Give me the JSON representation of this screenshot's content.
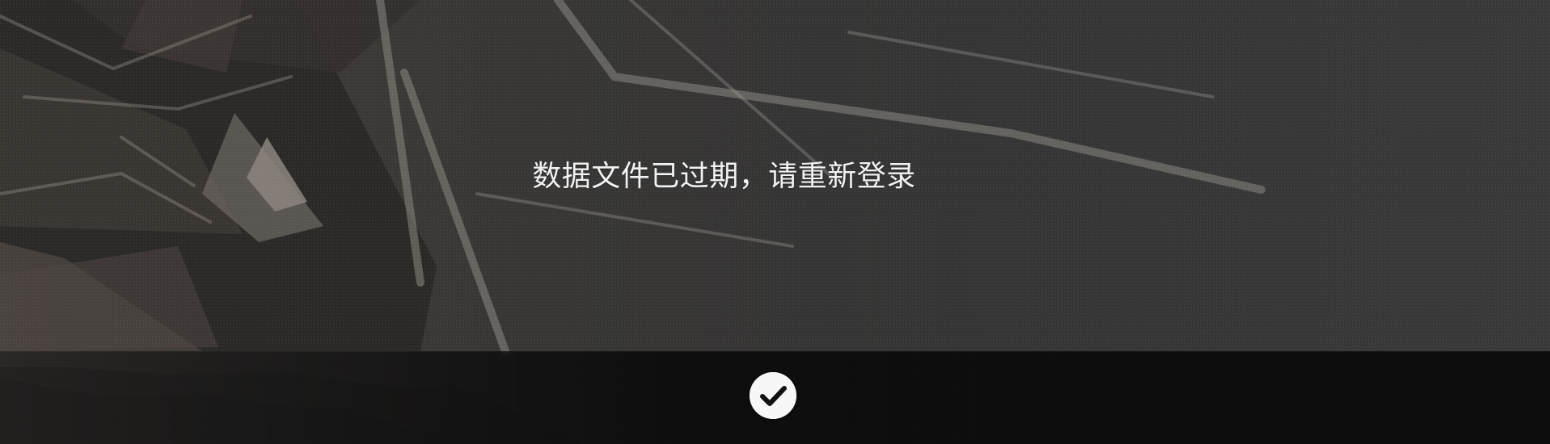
{
  "dialog": {
    "message": "数据文件已过期，请重新登录",
    "confirm_icon": "check-icon"
  },
  "colors": {
    "background": "#333333",
    "action_bar": "#0c0c0c",
    "text": "#f2f2f2",
    "button": "#f7f7f7",
    "button_icon": "#111111"
  }
}
